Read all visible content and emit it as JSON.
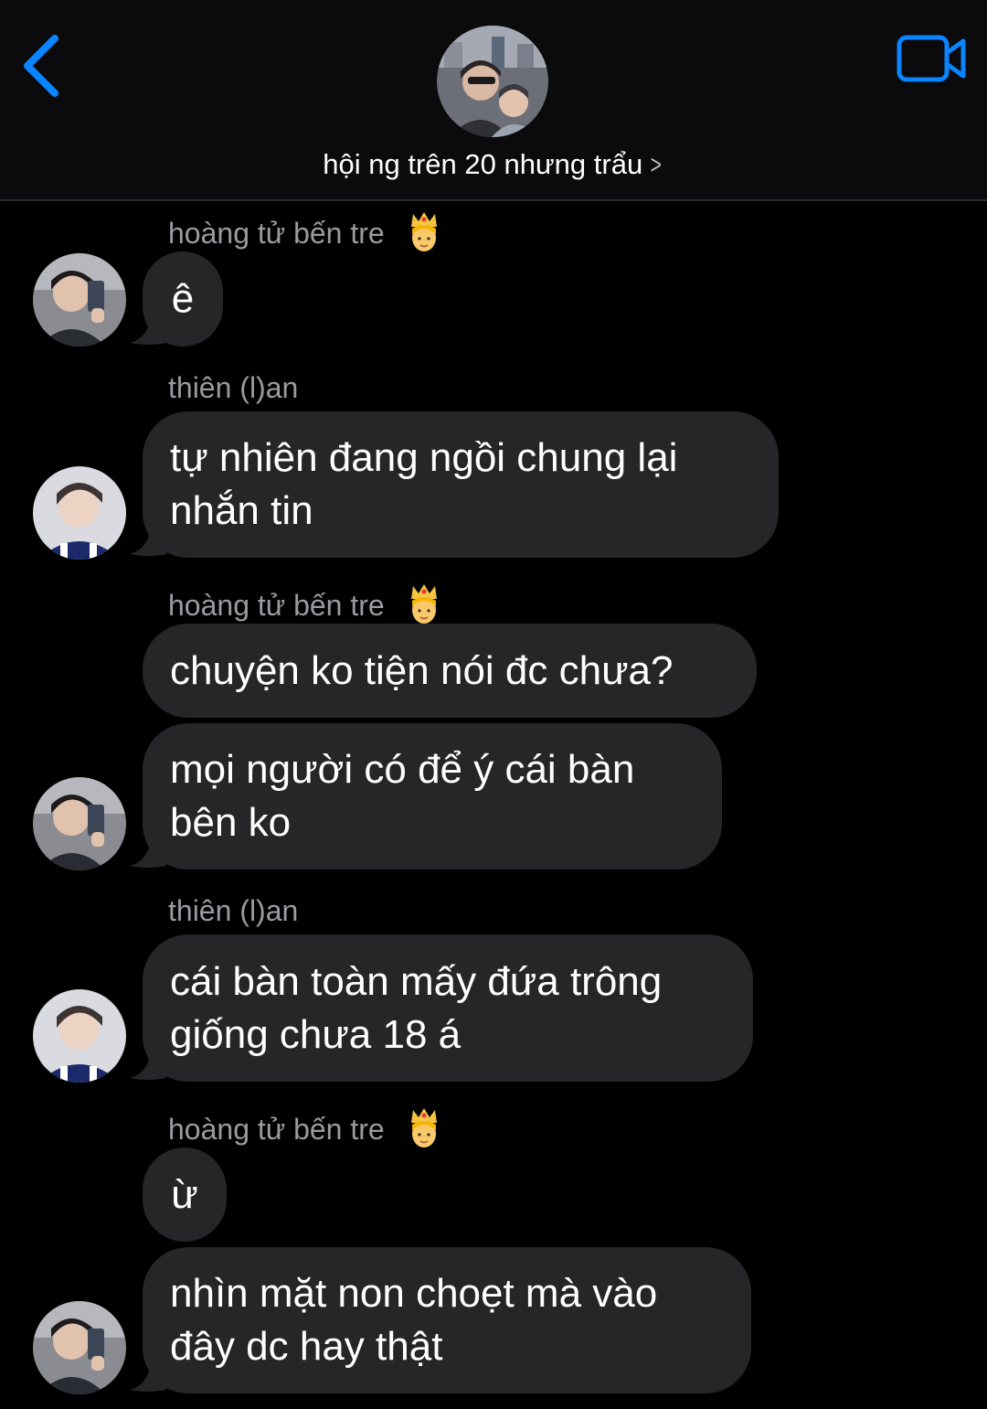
{
  "header": {
    "title": "hội ng trên 20 nhưng trẩu",
    "back_icon": "chevron-left-icon",
    "video_icon": "video-camera-icon",
    "accent_color": "#0a84ff"
  },
  "messages": [
    {
      "sender": "hoàng tử bến tre",
      "text": "ê"
    },
    {
      "sender": "thiên (l)an",
      "text": "tự nhiên đang ngồi chung lại nhắn tin"
    },
    {
      "sender": "hoàng tử bến tre",
      "text": "chuyện ko tiện nói đc chưa?"
    },
    {
      "sender": "",
      "text": "mọi người có để ý cái bàn bên ko"
    },
    {
      "sender": "thiên (l)an",
      "text": "cái bàn toàn mấy đứa trông giống chưa 18 á"
    },
    {
      "sender": "hoàng tử bến tre",
      "text": "ừ"
    },
    {
      "sender": "",
      "text": "nhìn mặt non choẹt mà vào đây dc hay thật"
    }
  ],
  "colors": {
    "background": "#000000",
    "bubble": "#262628",
    "sender_name": "#9a9aa0"
  }
}
